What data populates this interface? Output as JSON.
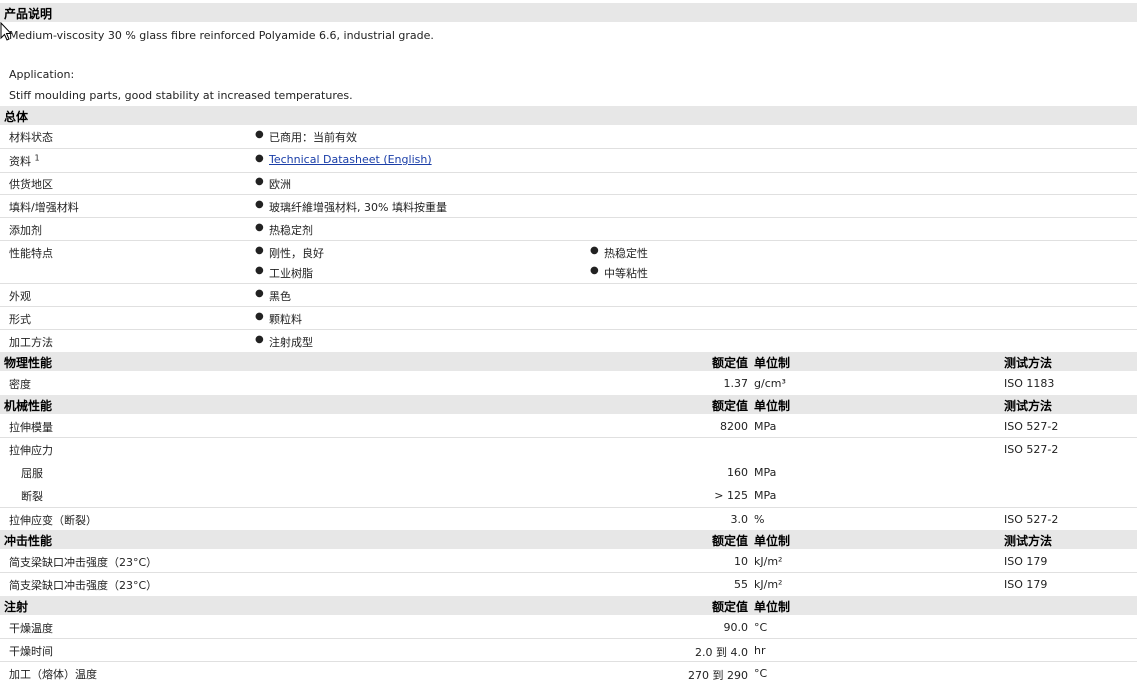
{
  "sections": {
    "product_desc": "产品说明",
    "general": "总体",
    "physical": "物理性能",
    "mechanical": "机械性能",
    "impact": "冲击性能",
    "injection": "注射"
  },
  "columns": {
    "value": "额定值",
    "unit": "单位制",
    "method": "测试方法"
  },
  "description": {
    "line1": "Medium-viscosity 30 % glass fibre reinforced Polyamide 6.6, industrial grade.",
    "line2": "Application:",
    "line3": "Stiff moulding parts, good stability at increased temperatures."
  },
  "general_rows": [
    {
      "label": "材料状态",
      "values": [
        "已商用：当前有效"
      ]
    },
    {
      "label": "资料",
      "sup": "1",
      "values": [
        "Technical Datasheet (English)"
      ]
    },
    {
      "label": "供货地区",
      "values": [
        "欧洲"
      ]
    },
    {
      "label": "填料/增强材料",
      "values": [
        "玻璃纤維增强材料, 30% 填料按重量"
      ]
    },
    {
      "label": "添加剂",
      "values": [
        "热稳定剂"
      ]
    },
    {
      "label": "性能特点",
      "values": [
        "刚性，良好",
        "热稳定性",
        "工业树脂",
        "中等粘性"
      ]
    },
    {
      "label": "外观",
      "values": [
        "黑色"
      ]
    },
    {
      "label": "形式",
      "values": [
        "颗粒料"
      ]
    },
    {
      "label": "加工方法",
      "values": [
        "注射成型"
      ]
    }
  ],
  "physical_rows": [
    {
      "label": "密度",
      "value": "1.37",
      "unit": "g/cm³",
      "method": "ISO 1183"
    }
  ],
  "mechanical_rows": [
    {
      "label": "拉伸模量",
      "value": "8200",
      "unit": "MPa",
      "method": "ISO 527-2"
    },
    {
      "label": "拉伸应力",
      "value": "",
      "unit": "",
      "method": "ISO 527-2"
    },
    {
      "label": "屈服",
      "value": "160",
      "unit": "MPa",
      "method": ""
    },
    {
      "label": "断裂",
      "value": "> 125",
      "unit": "MPa",
      "method": ""
    },
    {
      "label": "拉伸应变（断裂）",
      "value": "3.0",
      "unit": "%",
      "method": "ISO 527-2"
    }
  ],
  "impact_rows": [
    {
      "label": "简支梁缺口冲击强度（23°C）",
      "value": "10",
      "unit": "kJ/m²",
      "method": "ISO 179"
    },
    {
      "label": "简支梁缺口冲击强度（23°C）",
      "value": "55",
      "unit": "kJ/m²",
      "method": "ISO 179"
    }
  ],
  "injection_rows": [
    {
      "label": "干燥温度",
      "value": "90.0",
      "unit": "°C"
    },
    {
      "label": "干燥时间",
      "value": "2.0 到  4.0",
      "unit": "hr"
    },
    {
      "label": "加工（熔体）温度",
      "value": "270 到  290",
      "unit": "°C"
    }
  ]
}
